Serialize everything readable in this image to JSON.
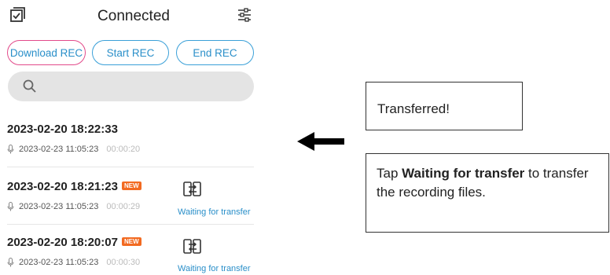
{
  "header": {
    "title": "Connected",
    "left_icon": "checklist-icon",
    "right_icon": "sliders-icon"
  },
  "buttons": {
    "download": "Download REC",
    "start": "Start REC",
    "end": "End REC"
  },
  "search": {
    "icon": "search-icon"
  },
  "recordings": [
    {
      "title": "2023-02-20 18:22:33",
      "date": "2023-02-23 11:05:23",
      "duration": "00:00:20",
      "badge": "",
      "status": ""
    },
    {
      "title": "2023-02-20 18:21:23",
      "date": "2023-02-23 11:05:23",
      "duration": "00:00:29",
      "badge": "NEW",
      "status": "Waiting for transfer"
    },
    {
      "title": "2023-02-20 18:20:07",
      "date": "2023-02-23 11:05:23",
      "duration": "00:00:30",
      "badge": "NEW",
      "status": "Waiting for transfer"
    }
  ],
  "callouts": {
    "transferred": "Transferred!",
    "instruction_prefix": "Tap ",
    "instruction_bold": "Waiting for transfer",
    "instruction_suffix": " to transfer the recording files."
  },
  "colors": {
    "accent": "#2a8fc9",
    "download_border": "#e24a8a",
    "badge": "#f26a21",
    "search_bg": "#e4e4e4"
  }
}
